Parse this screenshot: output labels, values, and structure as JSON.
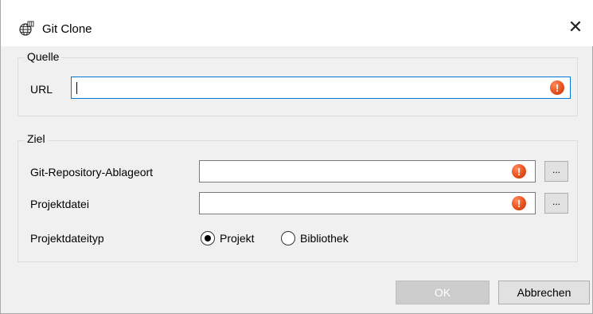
{
  "window": {
    "title": "Git Clone",
    "close_glyph": "✕",
    "icon": "globe-network-icon"
  },
  "source": {
    "legend": "Quelle",
    "url_label": "URL",
    "url_value": ""
  },
  "target": {
    "legend": "Ziel",
    "repo_location_label": "Git-Repository-Ablageort",
    "repo_location_value": "",
    "project_file_label": "Projektdatei",
    "project_file_value": "",
    "browse_label": "...",
    "file_type_label": "Projektdateityp",
    "file_type_options": [
      {
        "label": "Projekt",
        "selected": true
      },
      {
        "label": "Bibliothek",
        "selected": false
      }
    ]
  },
  "error_glyph": "!",
  "footer": {
    "ok_label": "OK",
    "cancel_label": "Abbrechen"
  },
  "colors": {
    "focus_border": "#0078d7",
    "error_icon": "#e8501c",
    "disabled_button": "#cccccc"
  }
}
